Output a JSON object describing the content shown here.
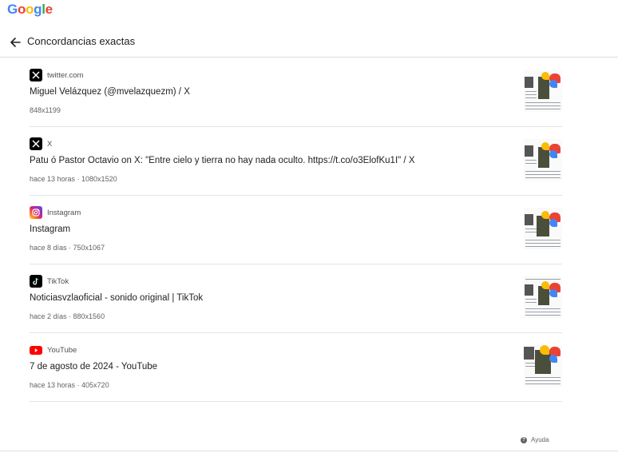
{
  "logo": {
    "text": "Google"
  },
  "header": {
    "title": "Concordancias exactas"
  },
  "results": [
    {
      "source": "twitter.com",
      "icon": "x-icon",
      "title": "Miguel Velázquez (@mvelazquezm) / X",
      "meta": "848x1199"
    },
    {
      "source": "X",
      "icon": "x-icon",
      "title": "Patu ó Pastor Octavio on X: \"Entre cielo y tierra no hay nada oculto. https://t.co/o3ElofKu1I\" / X",
      "meta": "hace 13 horas · 1080x1520"
    },
    {
      "source": "Instagram",
      "icon": "instagram-icon",
      "title": "Instagram",
      "meta": "hace 8 días · 750x1067"
    },
    {
      "source": "TikTok",
      "icon": "tiktok-icon",
      "title": "Noticiasvzlaoficial - sonido original | TikTok",
      "meta": "hace 2 días · 880x1560"
    },
    {
      "source": "YouTube",
      "icon": "youtube-icon",
      "title": "7 de agosto de 2024 - YouTube",
      "meta": "hace 13 horas · 405x720"
    }
  ],
  "footer": {
    "help": "Ayuda"
  },
  "colors": {
    "g_blue": "#4285F4",
    "g_red": "#EA4335",
    "g_yellow": "#FBBC05",
    "g_green": "#34A853",
    "youtube": "#FF0000",
    "divider": "#dadce0"
  }
}
